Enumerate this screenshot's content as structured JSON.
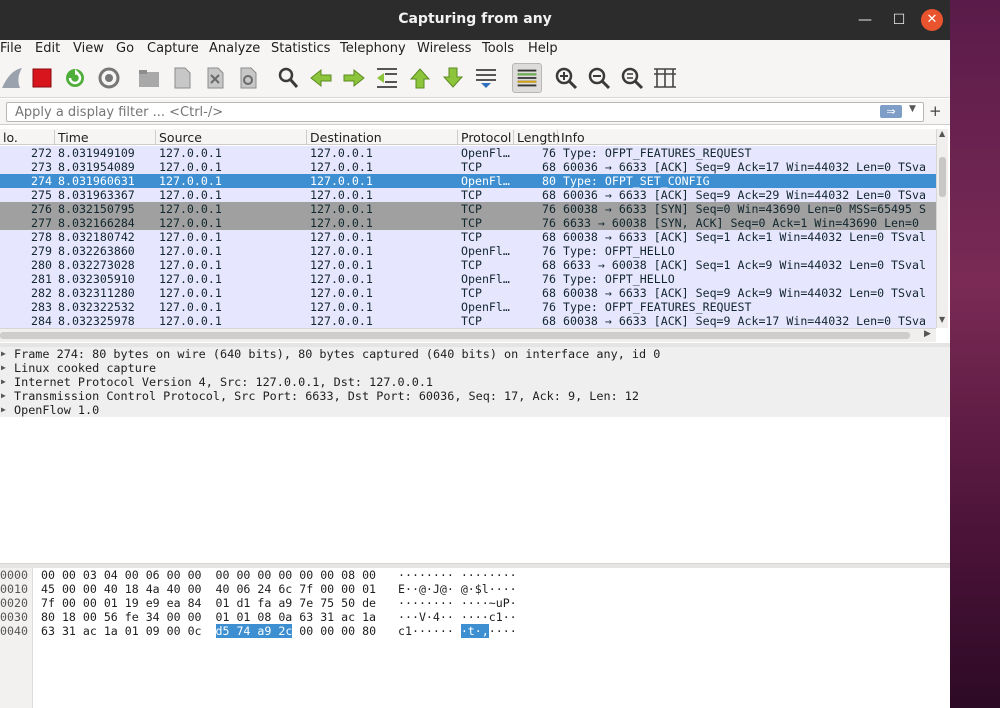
{
  "window": {
    "title": "Capturing from any"
  },
  "menu": [
    "File",
    "Edit",
    "View",
    "Go",
    "Capture",
    "Analyze",
    "Statistics",
    "Telephony",
    "Wireless",
    "Tools",
    "Help"
  ],
  "toolbar": {
    "icons": [
      "shark-fin-start-icon",
      "stop-capture-icon",
      "restart-capture-icon",
      "capture-options-icon",
      "open-file-icon",
      "save-file-icon",
      "close-file-icon",
      "reload-file-icon",
      "find-packet-icon",
      "go-back-icon",
      "go-forward-icon",
      "go-to-packet-icon",
      "go-first-icon",
      "go-last-icon",
      "autoscroll-icon",
      "colorize-icon",
      "zoom-in-icon",
      "zoom-out-icon",
      "zoom-normal-icon",
      "resize-columns-icon"
    ]
  },
  "filter": {
    "placeholder": "Apply a display filter ... <Ctrl-/>",
    "apply_label": "⇒",
    "add_label": "+"
  },
  "columns": {
    "no": "lo.",
    "time": "Time",
    "source": "Source",
    "destination": "Destination",
    "protocol": "Protocol",
    "length": "Length",
    "info": "Info"
  },
  "packets": [
    {
      "no": "272",
      "time": "8.031949109",
      "src": "127.0.0.1",
      "dst": "127.0.0.1",
      "proto": "OpenFl…",
      "len": "76",
      "info": "Type: OFPT_FEATURES_REQUEST",
      "style": "openflow"
    },
    {
      "no": "273",
      "time": "8.031954089",
      "src": "127.0.0.1",
      "dst": "127.0.0.1",
      "proto": "TCP",
      "len": "68",
      "info": "60036 → 6633 [ACK] Seq=9 Ack=17 Win=44032 Len=0 TSva",
      "style": "tcp"
    },
    {
      "no": "274",
      "time": "8.031960631",
      "src": "127.0.0.1",
      "dst": "127.0.0.1",
      "proto": "OpenFl…",
      "len": "80",
      "info": "Type: OFPT_SET_CONFIG",
      "style": "sel"
    },
    {
      "no": "275",
      "time": "8.031963367",
      "src": "127.0.0.1",
      "dst": "127.0.0.1",
      "proto": "TCP",
      "len": "68",
      "info": "60036 → 6633 [ACK] Seq=9 Ack=29 Win=44032 Len=0 TSva",
      "style": "tcp"
    },
    {
      "no": "276",
      "time": "8.032150795",
      "src": "127.0.0.1",
      "dst": "127.0.0.1",
      "proto": "TCP",
      "len": "76",
      "info": "60038 → 6633 [SYN] Seq=0 Win=43690 Len=0 MSS=65495 S",
      "style": "syn"
    },
    {
      "no": "277",
      "time": "8.032166284",
      "src": "127.0.0.1",
      "dst": "127.0.0.1",
      "proto": "TCP",
      "len": "76",
      "info": "6633 → 60038 [SYN, ACK] Seq=0 Ack=1 Win=43690 Len=0",
      "style": "syn"
    },
    {
      "no": "278",
      "time": "8.032180742",
      "src": "127.0.0.1",
      "dst": "127.0.0.1",
      "proto": "TCP",
      "len": "68",
      "info": "60038 → 6633 [ACK] Seq=1 Ack=1 Win=44032 Len=0 TSval",
      "style": "tcp"
    },
    {
      "no": "279",
      "time": "8.032263860",
      "src": "127.0.0.1",
      "dst": "127.0.0.1",
      "proto": "OpenFl…",
      "len": "76",
      "info": "Type: OFPT_HELLO",
      "style": "openflow"
    },
    {
      "no": "280",
      "time": "8.032273028",
      "src": "127.0.0.1",
      "dst": "127.0.0.1",
      "proto": "TCP",
      "len": "68",
      "info": "6633 → 60038 [ACK] Seq=1 Ack=9 Win=44032 Len=0 TSval",
      "style": "tcp"
    },
    {
      "no": "281",
      "time": "8.032305910",
      "src": "127.0.0.1",
      "dst": "127.0.0.1",
      "proto": "OpenFl…",
      "len": "76",
      "info": "Type: OFPT_HELLO",
      "style": "openflow"
    },
    {
      "no": "282",
      "time": "8.032311280",
      "src": "127.0.0.1",
      "dst": "127.0.0.1",
      "proto": "TCP",
      "len": "68",
      "info": "60038 → 6633 [ACK] Seq=9 Ack=9 Win=44032 Len=0 TSval",
      "style": "tcp"
    },
    {
      "no": "283",
      "time": "8.032322532",
      "src": "127.0.0.1",
      "dst": "127.0.0.1",
      "proto": "OpenFl…",
      "len": "76",
      "info": "Type: OFPT_FEATURES_REQUEST",
      "style": "openflow"
    },
    {
      "no": "284",
      "time": "8.032325978",
      "src": "127.0.0.1",
      "dst": "127.0.0.1",
      "proto": "TCP",
      "len": "68",
      "info": "60038 → 6633 [ACK] Seq=9 Ack=17 Win=44032 Len=0 TSva",
      "style": "tcp"
    }
  ],
  "details": [
    "Frame 274: 80 bytes on wire (640 bits), 80 bytes captured (640 bits) on interface any, id 0",
    "Linux cooked capture",
    "Internet Protocol Version 4, Src: 127.0.0.1, Dst: 127.0.0.1",
    "Transmission Control Protocol, Src Port: 6633, Dst Port: 60036, Seq: 17, Ack: 9, Len: 12",
    "OpenFlow 1.0"
  ],
  "bytes": [
    {
      "off": "0000",
      "hex": "00 00 03 04 00 06 00 00  00 00 00 00 00 00 08 00",
      "ascii": "········ ········"
    },
    {
      "off": "0010",
      "hex": "45 00 00 40 18 4a 40 00  40 06 24 6c 7f 00 00 01",
      "ascii": "E··@·J@· @·$l····"
    },
    {
      "off": "0020",
      "hex": "7f 00 00 01 19 e9 ea 84  01 d1 fa a9 7e 75 50 de",
      "ascii": "········ ····~uP·"
    },
    {
      "off": "0030",
      "hex": "80 18 00 56 fe 34 00 00  01 01 08 0a 63 31 ac 1a",
      "ascii": "···V·4·· ····c1··"
    },
    {
      "off": "0040",
      "hex_pre": "63 31 ac 1a 01 09 00 0c  ",
      "hex_hl": "d5 74 a9 2c",
      "hex_post": " 00 00 00 80",
      "ascii_pre": "c1······ ",
      "ascii_hl": "·t·,",
      "ascii_post": "····"
    }
  ]
}
